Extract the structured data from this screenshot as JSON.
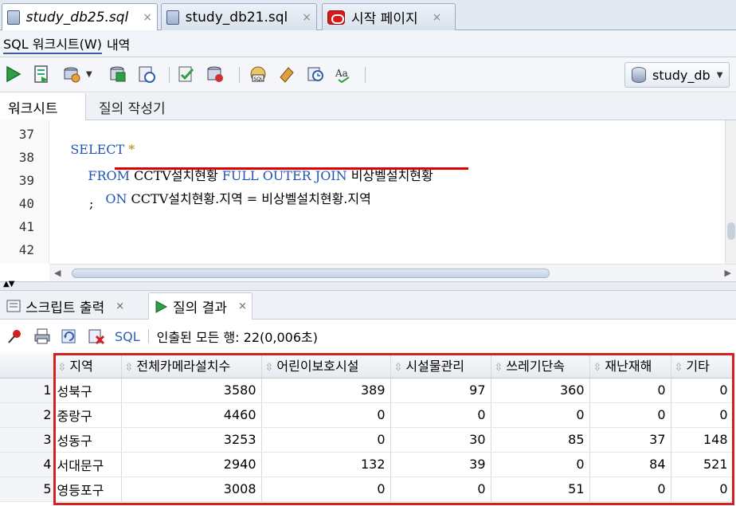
{
  "doc_tabs": [
    {
      "label": "study_db25.sql",
      "icon": "sql-file-icon",
      "italic": true
    },
    {
      "label": "study_db21.sql",
      "icon": "sql-file-icon",
      "italic": false
    },
    {
      "label": "시작 페이지",
      "icon": "oracle-start-icon",
      "italic": false
    }
  ],
  "close_glyph": "×",
  "sub_tabs": [
    "SQL 워크시트(W)",
    "내역"
  ],
  "connection": "study_db",
  "worksheet_tabs": [
    "워크시트",
    "질의 작성기"
  ],
  "editor": {
    "line_numbers": [
      "37",
      "38",
      "39",
      "40",
      "41",
      "42"
    ],
    "lines": {
      "l37_kw": "SELECT",
      "l37_rest": " *",
      "l38_kw1": "FROM",
      "l38_t1": " CCTV설치현황 ",
      "l38_kw2": "FULL OUTER JOIN",
      "l38_t2": " 비상벨설치현황",
      "l39_kw": "ON",
      "l39_rest": " CCTV설치현황.지역 = 비상벨설치현황.지역",
      "l40": ";"
    }
  },
  "results": {
    "tabs": [
      {
        "label": "스크립트 출력",
        "icon": "script-output-icon"
      },
      {
        "label": "질의 결과",
        "icon": "run-result-icon"
      }
    ],
    "sql_label": "SQL",
    "status": "인출된 모든 행: 22(0,006초)",
    "columns": [
      "지역",
      "전체카메라설치수",
      "어린이보호시설",
      "시설물관리",
      "쓰레기단속",
      "재난재해",
      "기타"
    ],
    "rows": [
      [
        "1",
        "성북구",
        "3580",
        "389",
        "97",
        "360",
        "0",
        "0"
      ],
      [
        "2",
        "중랑구",
        "4460",
        "0",
        "0",
        "0",
        "0",
        "0"
      ],
      [
        "3",
        "성동구",
        "3253",
        "0",
        "30",
        "85",
        "37",
        "148"
      ],
      [
        "4",
        "서대문구",
        "2940",
        "132",
        "39",
        "0",
        "84",
        "521"
      ],
      [
        "5",
        "영등포구",
        "3008",
        "0",
        "0",
        "51",
        "0",
        "0"
      ]
    ]
  },
  "colors": {
    "accent_red": "#d42020",
    "keyword_blue": "#2254b8"
  }
}
